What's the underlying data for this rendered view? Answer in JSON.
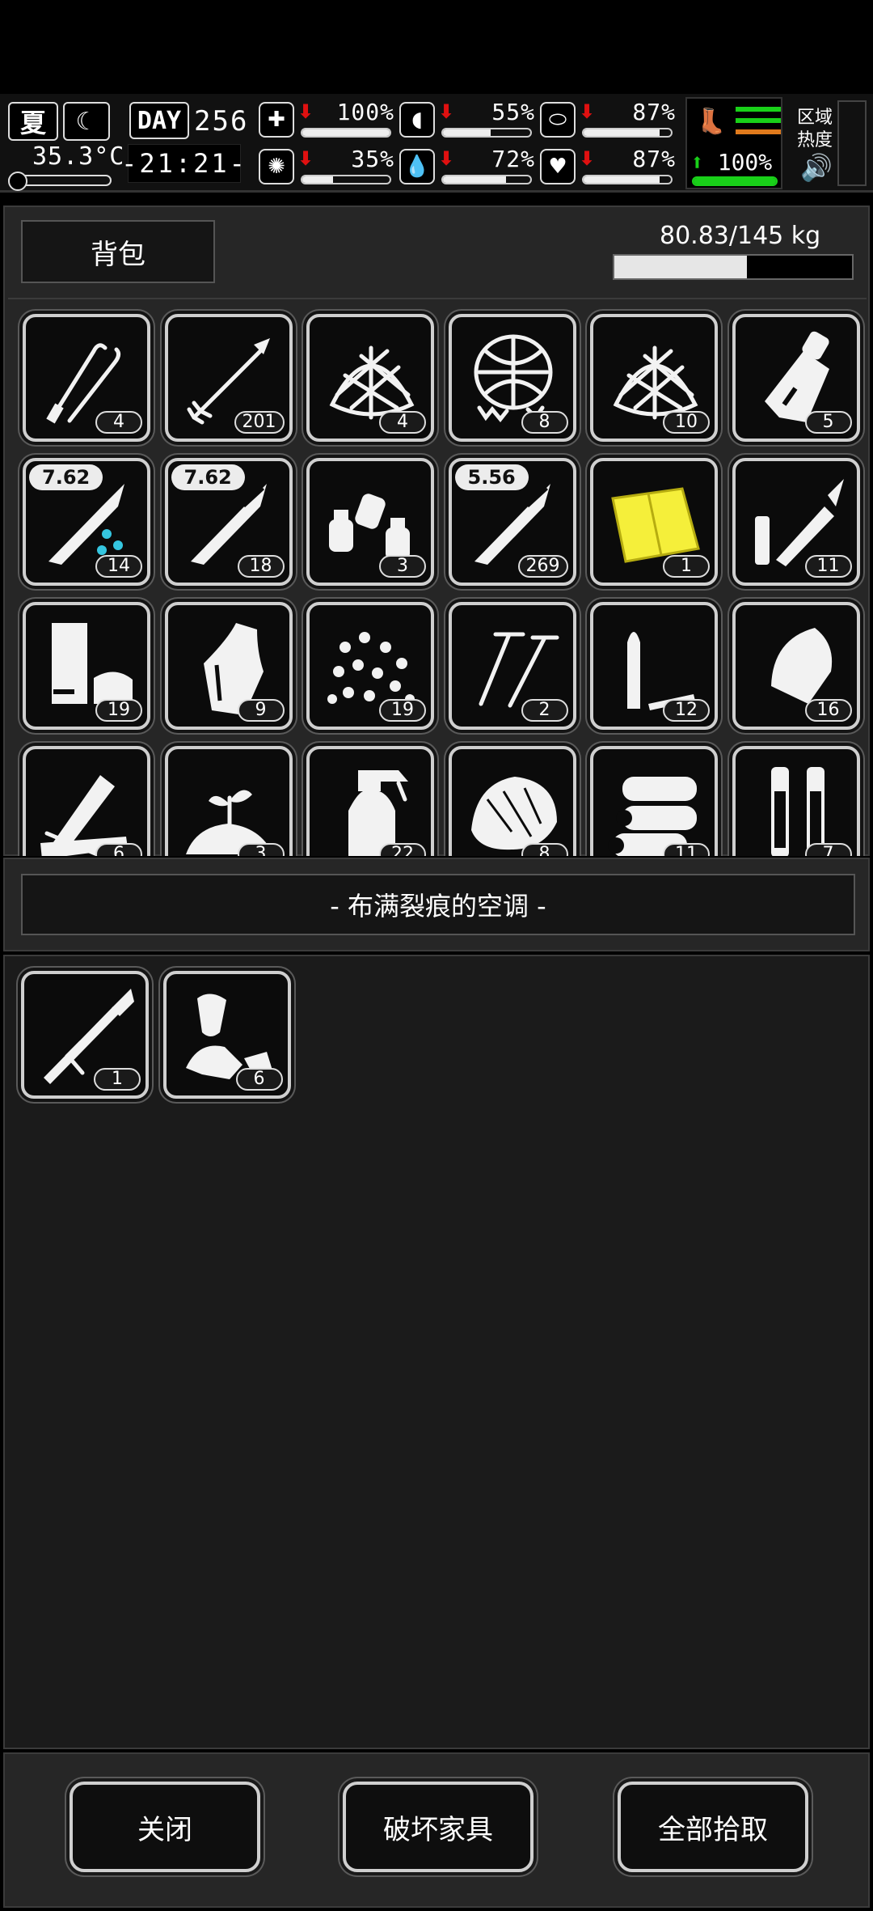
{
  "status": {
    "season": "夏",
    "weather_icon": "cloudy-night-icon",
    "temperature": "35.3°C",
    "day_label": "DAY",
    "day_number": "256",
    "clock": "-21:21-",
    "stats": [
      {
        "name": "health",
        "icon": "medkit-icon",
        "glyph": "✚",
        "trend": "down",
        "value": "100%",
        "fill": 1.0
      },
      {
        "name": "hunger",
        "icon": "stomach-icon",
        "glyph": "◖",
        "trend": "down",
        "value": "55%",
        "fill": 0.55
      },
      {
        "name": "immunity",
        "icon": "pill-icon",
        "glyph": "⬭",
        "trend": "down",
        "value": "87%",
        "fill": 0.87
      },
      {
        "name": "sanity",
        "icon": "brain-icon",
        "glyph": "✺",
        "trend": "down",
        "value": "35%",
        "fill": 0.35
      },
      {
        "name": "thirst",
        "icon": "water-drop-icon",
        "glyph": "💧",
        "trend": "down",
        "value": "72%",
        "fill": 0.72
      },
      {
        "name": "mood",
        "icon": "heart-icon",
        "glyph": "♥",
        "trend": "down",
        "value": "87%",
        "fill": 0.87
      }
    ],
    "stamina": {
      "value": "100%",
      "fill": 1.0,
      "trend": "up"
    },
    "area_heat_label": "区域\n热度",
    "colors": {
      "trend_down": "#e01010",
      "trend_up": "#19d019",
      "stamina": "#19d019",
      "stamina_secondary": "#e07a1c"
    }
  },
  "backpack": {
    "tab_label": "背包",
    "weight_text": "80.83/145 kg",
    "weight_fill": 0.557,
    "items": [
      {
        "icon": "lockpick-icon",
        "count": "4"
      },
      {
        "icon": "arrow-icon",
        "count": "201"
      },
      {
        "icon": "net-icon",
        "count": "4"
      },
      {
        "icon": "torn-net-icon",
        "count": "8"
      },
      {
        "icon": "net-icon",
        "count": "10"
      },
      {
        "icon": "battery-pack-icon",
        "count": "5"
      },
      {
        "icon": "bullet-wet-icon",
        "tag": "7.62",
        "count": "14"
      },
      {
        "icon": "bullet-icon",
        "tag": "7.62",
        "count": "18"
      },
      {
        "icon": "spray-cans-icon",
        "count": "3"
      },
      {
        "icon": "bullet-icon",
        "tag": "5.56",
        "count": "269"
      },
      {
        "icon": "yellow-cloth-icon",
        "count": "1"
      },
      {
        "icon": "syringe-icon",
        "count": "11"
      },
      {
        "icon": "shell-casing-icon",
        "count": "19"
      },
      {
        "icon": "bottle-icon",
        "count": "9"
      },
      {
        "icon": "pellets-icon",
        "count": "19"
      },
      {
        "icon": "screws-icon",
        "count": "2"
      },
      {
        "icon": "bullet-tips-icon",
        "count": "12"
      },
      {
        "icon": "bullet-head-icon",
        "count": "16"
      },
      {
        "icon": "wood-planks-icon",
        "count": "6"
      },
      {
        "icon": "soil-sprout-icon",
        "count": "3"
      },
      {
        "icon": "spray-bottle-icon",
        "count": "22"
      },
      {
        "icon": "fiber-icon",
        "count": "8"
      },
      {
        "icon": "logs-icon",
        "count": "11"
      },
      {
        "icon": "gunpowder-tubes-icon",
        "count": "7"
      }
    ]
  },
  "container": {
    "title": "- 布满裂痕的空调 -",
    "items": [
      {
        "icon": "rpg-launcher-icon",
        "count": "1"
      },
      {
        "icon": "scrap-metal-icon",
        "count": "6"
      }
    ]
  },
  "footer": {
    "close_label": "关闭",
    "destroy_label": "破坏家具",
    "take_all_label": "全部拾取"
  }
}
